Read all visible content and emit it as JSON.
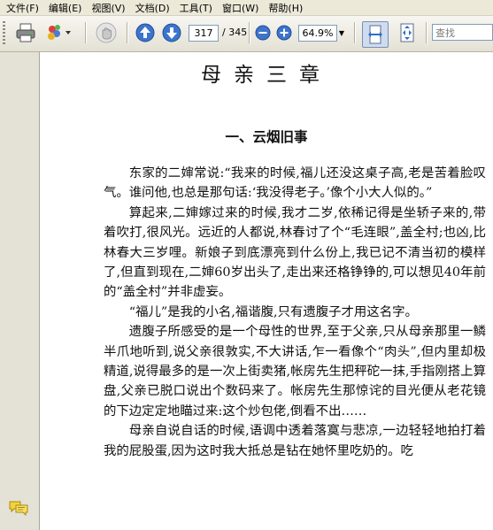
{
  "menubar": {
    "items": [
      "文件(F)",
      "编辑(E)",
      "视图(V)",
      "文档(D)",
      "工具(T)",
      "窗口(W)",
      "帮助(H)"
    ]
  },
  "toolbar": {
    "page_current": "317",
    "page_total": "/ 345",
    "zoom": "64.9%",
    "search_placeholder": "查找"
  },
  "document": {
    "book_title": "母亲三章",
    "chapter_title": "一、云烟旧事",
    "paragraphs": [
      "东家的二婶常说:“我来的时候,福儿还没这桌子高,老是苦着脸叹气。谁问他,也总是那句话:‘我没得老子。’像个小大人似的。”",
      "算起来,二婶嫁过来的时候,我才二岁,依稀记得是坐轿子来的,带着吹打,很风光。远近的人都说,林春讨了个“毛连眼”,盖全村;也凶,比林春大三岁哩。新娘子到底漂亮到什么份上,我已记不清当初的模样了,但直到现在,二婶60岁出头了,走出来还格铮铮的,可以想见40年前的“盖全村”并非虚妄。",
      "“福儿”是我的小名,福谐腹,只有遗腹子才用这名字。",
      "遗腹子所感受的是一个母性的世界,至于父亲,只从母亲那里一鳞半爪地听到,说父亲很敦实,不大讲话,乍一看像个“肉头”,但内里却极精道,说得最多的是一次上街卖猪,帐房先生把秤砣一抹,手指刚搭上算盘,父亲已脱口说出个数码来了。帐房先生那惊诧的目光便从老花镜的下边定定地瞄过来:这个炒包佬,倒看不出……",
      "母亲自说自话的时候,语调中透着落寞与悲凉,一边轻轻地拍打着我的屁股蛋,因为这时我大抵总是钻在她怀里吃奶的。吃"
    ]
  },
  "colors": {
    "menubar_bg": "#ece9d8",
    "toolbar_bg": "#e9e6da",
    "nav_bg": "#e4e2d6",
    "accent_blue": "#2f6cc4",
    "page_bg": "#ffffff"
  },
  "icons": {
    "print": "printer-icon",
    "collab": "collaborate-icon",
    "hand": "hand-tool-icon",
    "prev": "arrow-up-icon",
    "next": "arrow-down-icon",
    "zoom_out": "zoom-out-icon",
    "zoom_in": "zoom-in-icon",
    "fit_width": "fit-width-icon",
    "fit_page": "fit-page-icon",
    "comments": "comments-icon"
  }
}
